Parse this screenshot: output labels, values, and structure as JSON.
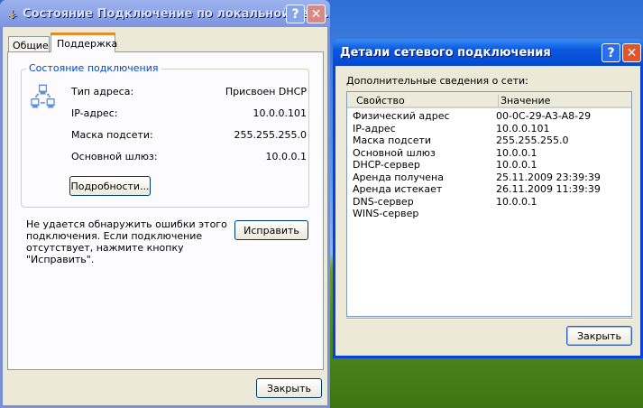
{
  "status_window": {
    "title": "Состояние Подключение по локальной сет...",
    "tabs": [
      "Общие",
      "Поддержка"
    ],
    "group_title": "Состояние подключения",
    "rows": [
      {
        "label": "Тип адреса:",
        "value": "Присвоен DHCP"
      },
      {
        "label": "IP-адрес:",
        "value": "10.0.0.101"
      },
      {
        "label": "Маска подсети:",
        "value": "255.255.255.0"
      },
      {
        "label": "Основной шлюз:",
        "value": "10.0.0.1"
      }
    ],
    "details_button": "Подробности...",
    "repair_text": "Не удается обнаружить ошибки этого подключения. Если подключение отсутствует, нажмите кнопку \"Исправить\".",
    "repair_button": "Исправить",
    "close_button": "Закрыть"
  },
  "details_window": {
    "title": "Детали сетевого подключения",
    "caption": "Дополнительные сведения о сети:",
    "columns": [
      "Свойство",
      "Значение"
    ],
    "rows": [
      [
        "Физический адрес",
        "00-0C-29-A3-A8-29"
      ],
      [
        "IP-адрес",
        "10.0.0.101"
      ],
      [
        "Маска подсети",
        "255.255.255.0"
      ],
      [
        "Основной шлюз",
        "10.0.0.1"
      ],
      [
        "DHCP-сервер",
        "10.0.0.1"
      ],
      [
        "Аренда получена",
        "25.11.2009 23:39:39"
      ],
      [
        "Аренда истекает",
        "26.11.2009 11:39:39"
      ],
      [
        "DNS-сервер",
        "10.0.0.1"
      ],
      [
        "WINS-сервер",
        ""
      ]
    ],
    "close_button": "Закрыть"
  }
}
